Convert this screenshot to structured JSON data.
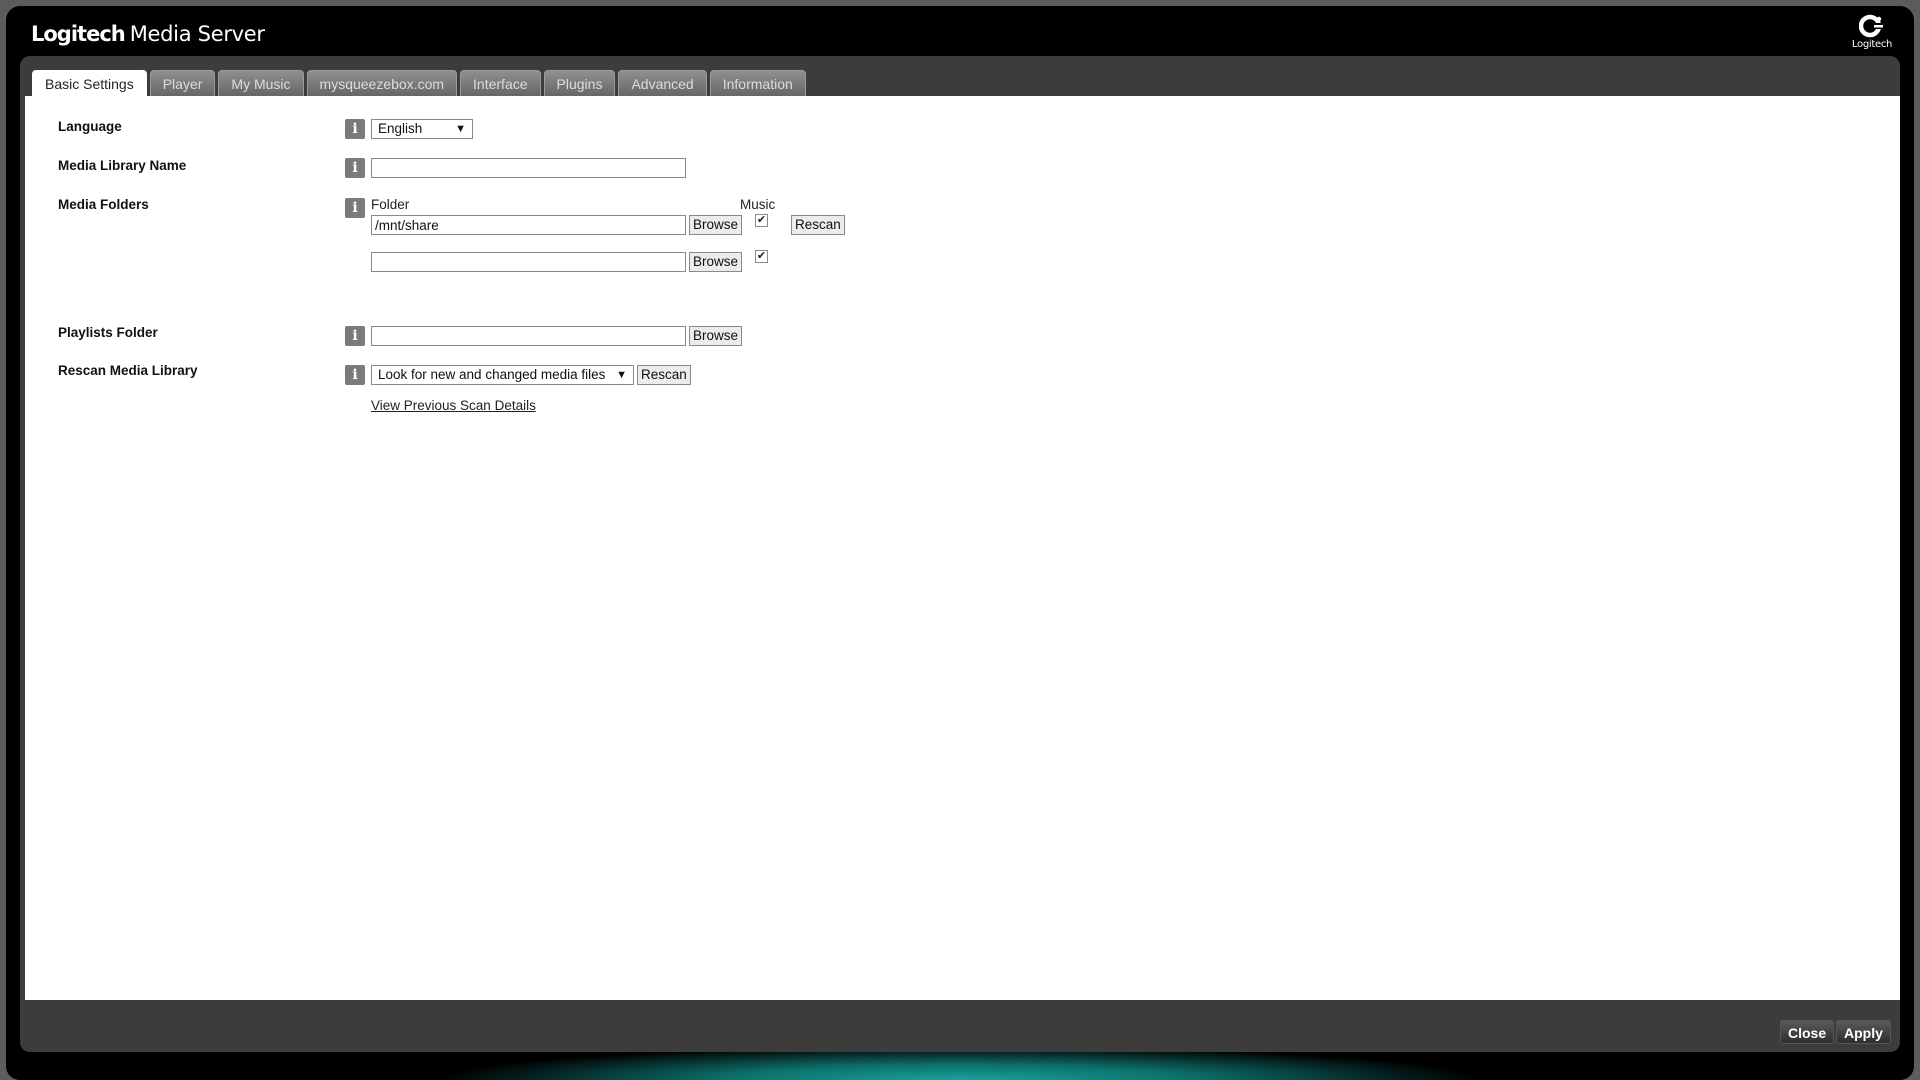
{
  "app": {
    "brand": "Logitech",
    "title": "Media Server",
    "logo_icon": "logitech-logo-icon",
    "logo_text": "Logitech"
  },
  "tabs": [
    {
      "label": "Basic Settings",
      "active": true
    },
    {
      "label": "Player"
    },
    {
      "label": "My Music"
    },
    {
      "label": "mysqueezebox.com"
    },
    {
      "label": "Interface"
    },
    {
      "label": "Plugins"
    },
    {
      "label": "Advanced"
    },
    {
      "label": "Information"
    }
  ],
  "settings": {
    "language": {
      "label": "Language",
      "value": "English"
    },
    "library_name": {
      "label": "Media Library Name",
      "value": ""
    },
    "media_folders": {
      "label": "Media Folders",
      "folder_col": "Folder",
      "music_col": "Music",
      "rows": [
        {
          "path": "/mnt/share",
          "browse": "Browse",
          "music_checked": true,
          "rescan": "Rescan"
        },
        {
          "path": "",
          "browse": "Browse",
          "music_checked": true
        }
      ]
    },
    "playlists": {
      "label": "Playlists Folder",
      "value": "",
      "browse": "Browse"
    },
    "rescan": {
      "label": "Rescan Media Library",
      "value": "Look for new and changed media files",
      "button": "Rescan",
      "details_link": "View Previous Scan Details"
    }
  },
  "info_icon": "info-icon",
  "footer": {
    "close": "Close",
    "apply": "Apply"
  },
  "colors": {
    "accent_glow": "#1aa39b",
    "panel": "#3c3c3c"
  }
}
